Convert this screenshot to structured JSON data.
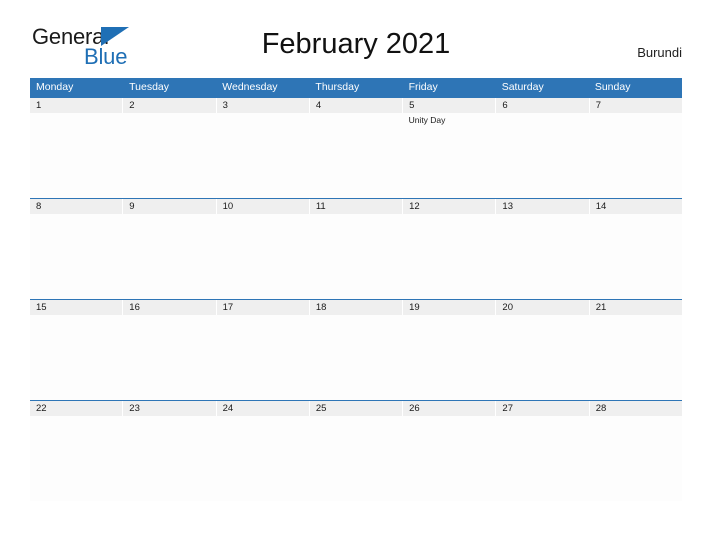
{
  "brand": {
    "name_part1": "General",
    "name_part2": "Blue",
    "triangle_color": "#1F6FB5"
  },
  "header": {
    "title": "February 2021",
    "country": "Burundi"
  },
  "theme": {
    "header_blue": "#2E75B6",
    "number_band_gray": "#EFEFEF",
    "text_color": "#1a1a1a"
  },
  "calendar": {
    "month": "February",
    "year": "2021",
    "week_start": "Monday",
    "weekdays": [
      "Monday",
      "Tuesday",
      "Wednesday",
      "Thursday",
      "Friday",
      "Saturday",
      "Sunday"
    ],
    "weeks": [
      {
        "days": [
          {
            "num": "1",
            "event": ""
          },
          {
            "num": "2",
            "event": ""
          },
          {
            "num": "3",
            "event": ""
          },
          {
            "num": "4",
            "event": ""
          },
          {
            "num": "5",
            "event": "Unity Day"
          },
          {
            "num": "6",
            "event": ""
          },
          {
            "num": "7",
            "event": ""
          }
        ]
      },
      {
        "days": [
          {
            "num": "8",
            "event": ""
          },
          {
            "num": "9",
            "event": ""
          },
          {
            "num": "10",
            "event": ""
          },
          {
            "num": "11",
            "event": ""
          },
          {
            "num": "12",
            "event": ""
          },
          {
            "num": "13",
            "event": ""
          },
          {
            "num": "14",
            "event": ""
          }
        ]
      },
      {
        "days": [
          {
            "num": "15",
            "event": ""
          },
          {
            "num": "16",
            "event": ""
          },
          {
            "num": "17",
            "event": ""
          },
          {
            "num": "18",
            "event": ""
          },
          {
            "num": "19",
            "event": ""
          },
          {
            "num": "20",
            "event": ""
          },
          {
            "num": "21",
            "event": ""
          }
        ]
      },
      {
        "days": [
          {
            "num": "22",
            "event": ""
          },
          {
            "num": "23",
            "event": ""
          },
          {
            "num": "24",
            "event": ""
          },
          {
            "num": "25",
            "event": ""
          },
          {
            "num": "26",
            "event": ""
          },
          {
            "num": "27",
            "event": ""
          },
          {
            "num": "28",
            "event": ""
          }
        ]
      }
    ]
  }
}
